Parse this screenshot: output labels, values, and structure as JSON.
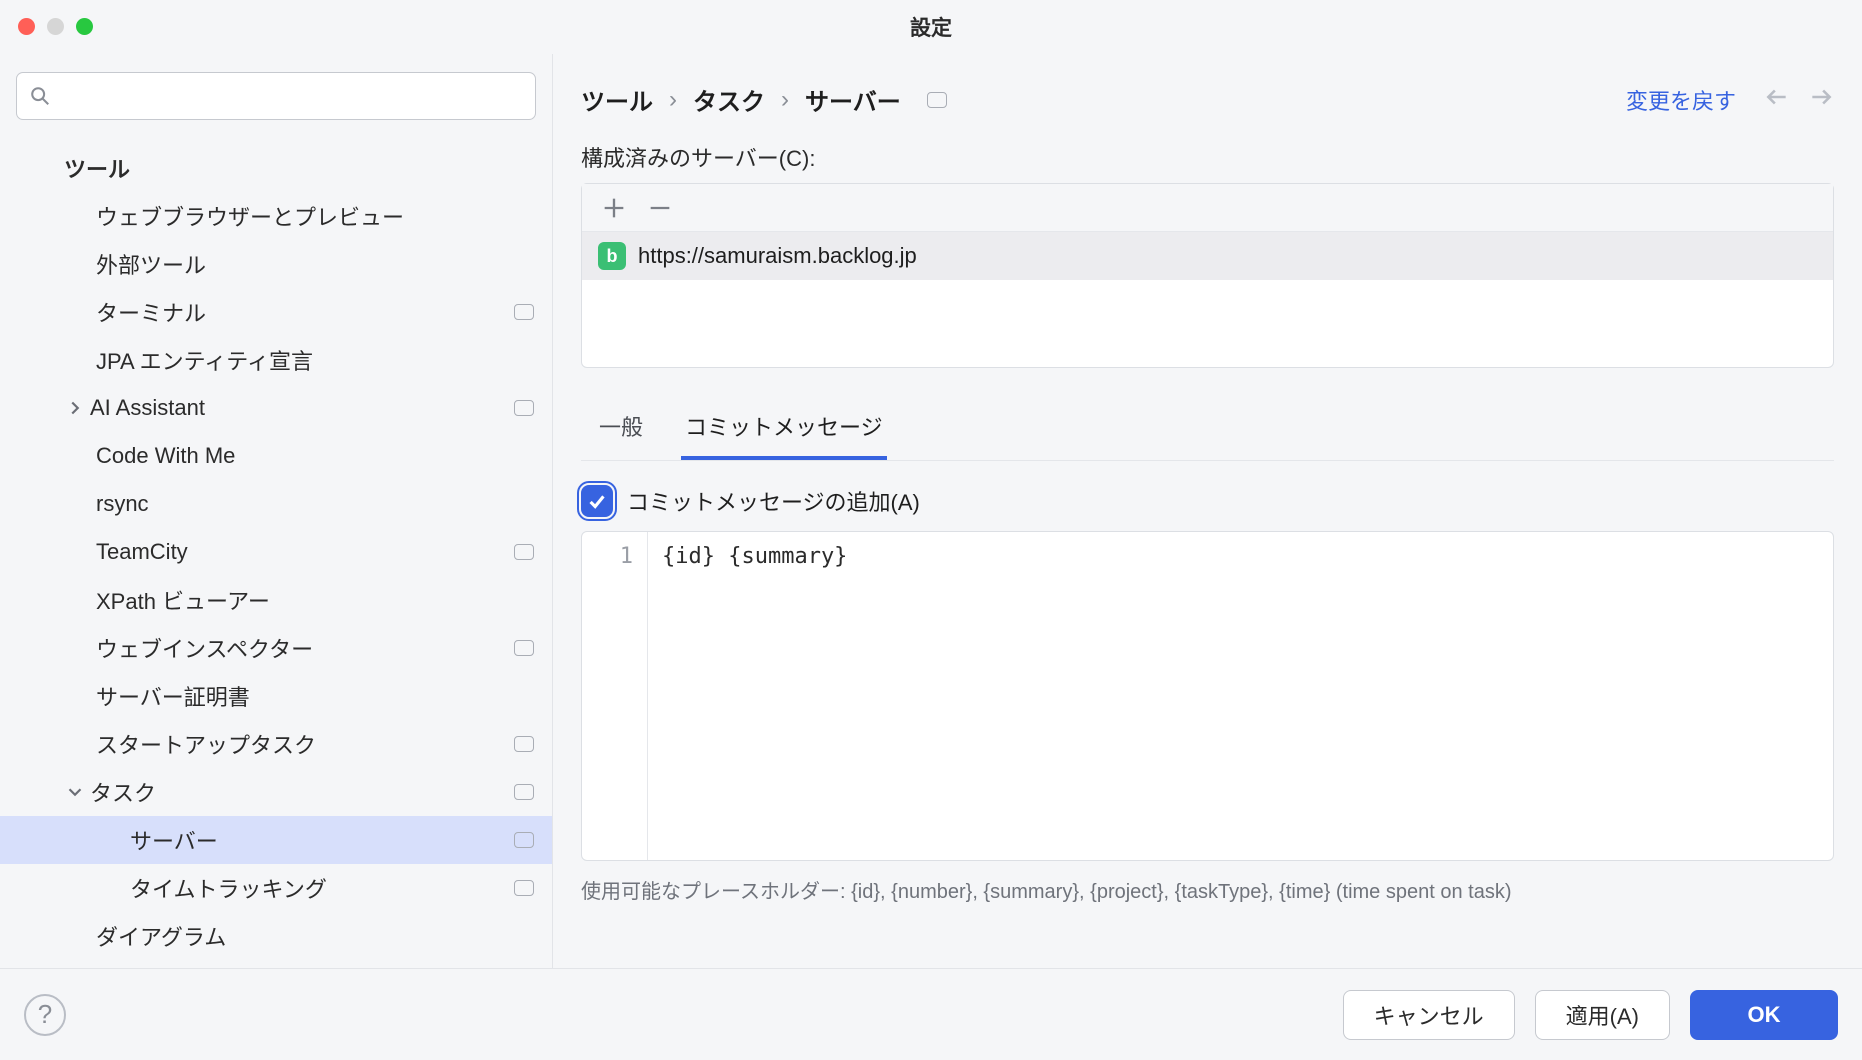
{
  "window": {
    "title": "設定"
  },
  "sidebar": {
    "search": {
      "placeholder": ""
    },
    "items": [
      {
        "label": "ツール",
        "indent": 0,
        "chev": "",
        "badge": false
      },
      {
        "label": "ウェブブラウザーとプレビュー",
        "indent": 1,
        "chev": "",
        "badge": false
      },
      {
        "label": "外部ツール",
        "indent": 1,
        "chev": "",
        "badge": false
      },
      {
        "label": "ターミナル",
        "indent": 1,
        "chev": "",
        "badge": true
      },
      {
        "label": "JPA エンティティ宣言",
        "indent": 1,
        "chev": "",
        "badge": false
      },
      {
        "label": "AI Assistant",
        "indent": 1,
        "chev": "right",
        "badge": true
      },
      {
        "label": "Code With Me",
        "indent": 1,
        "chev": "",
        "badge": false
      },
      {
        "label": "rsync",
        "indent": 1,
        "chev": "",
        "badge": false
      },
      {
        "label": "TeamCity",
        "indent": 1,
        "chev": "",
        "badge": true
      },
      {
        "label": "XPath ビューアー",
        "indent": 1,
        "chev": "",
        "badge": false
      },
      {
        "label": "ウェブインスペクター",
        "indent": 1,
        "chev": "",
        "badge": true
      },
      {
        "label": "サーバー証明書",
        "indent": 1,
        "chev": "",
        "badge": false
      },
      {
        "label": "スタートアップタスク",
        "indent": 1,
        "chev": "",
        "badge": true
      },
      {
        "label": "タスク",
        "indent": 1,
        "chev": "down",
        "badge": true
      },
      {
        "label": "サーバー",
        "indent": 2,
        "chev": "",
        "badge": true,
        "selected": true
      },
      {
        "label": "タイムトラッキング",
        "indent": 2,
        "chev": "",
        "badge": true
      },
      {
        "label": "ダイアグラム",
        "indent": 1,
        "chev": "",
        "badge": false
      }
    ]
  },
  "breadcrumb": {
    "part1": "ツール",
    "part2": "タスク",
    "part3": "サーバー"
  },
  "revert_label": "変更を戻す",
  "configured_servers_label": "構成済みのサーバー(C):",
  "servers": [
    {
      "url": "https://samuraism.backlog.jp"
    }
  ],
  "tabs": {
    "general": "一般",
    "commit_message": "コミットメッセージ"
  },
  "commit": {
    "checkbox_label": "コミットメッセージの追加(A)",
    "template_line_no": "1",
    "template_text": "{id} {summary}",
    "hint": "使用可能なプレースホルダー: {id}, {number}, {summary}, {project}, {taskType}, {time} (time spent on task)"
  },
  "footer": {
    "help": "?",
    "cancel": "キャンセル",
    "apply": "適用(A)",
    "ok": "OK"
  }
}
